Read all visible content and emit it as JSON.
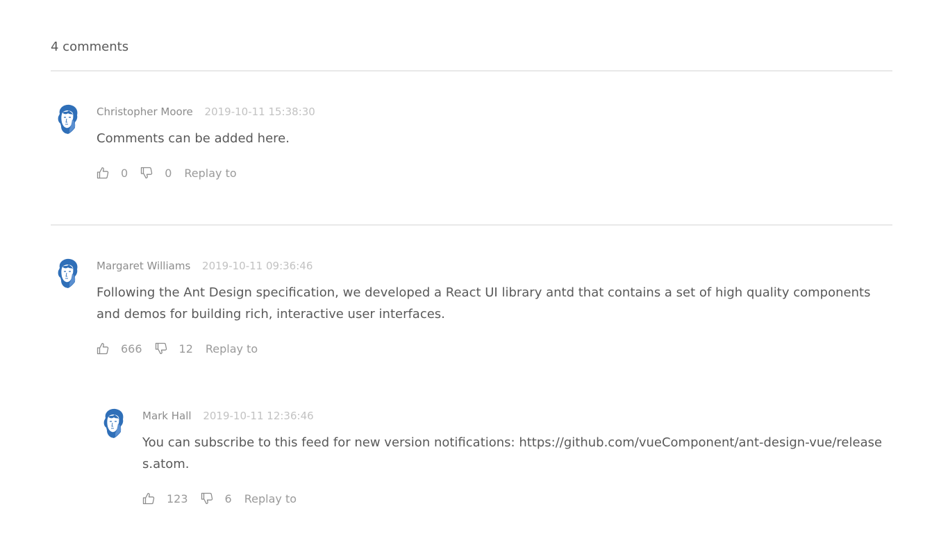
{
  "header": {
    "count_label": "4 comments"
  },
  "comments": [
    {
      "author": "Christopher Moore",
      "datetime": "2019-10-11 15:38:30",
      "content": "Comments can be added here.",
      "likes": "0",
      "dislikes": "0",
      "reply_label": "Replay to",
      "avatar_icon": "user-avatar-icon"
    },
    {
      "author": "Margaret Williams",
      "datetime": "2019-10-11 09:36:46",
      "content": "Following the Ant Design specification, we developed a React UI library antd that contains a set of high quality components and demos for building rich, interactive user interfaces.",
      "likes": "666",
      "dislikes": "12",
      "reply_label": "Replay to",
      "avatar_icon": "user-avatar-icon",
      "replies": [
        {
          "author": "Mark Hall",
          "datetime": "2019-10-11 12:36:46",
          "content": "You can subscribe to this feed for new version notifications: https://github.com/vueComponent/ant-design-vue/releases.atom.",
          "likes": "123",
          "dislikes": "6",
          "reply_label": "Replay to",
          "avatar_icon": "user-avatar-icon"
        }
      ]
    }
  ],
  "icons": {
    "like": "like-icon",
    "dislike": "dislike-icon"
  },
  "colors": {
    "text": "#595959",
    "meta_author": "#8c8c8c",
    "meta_time": "#c2c2c2",
    "divider": "#e8e8e8",
    "avatar_blue": "#2f6fb8"
  }
}
